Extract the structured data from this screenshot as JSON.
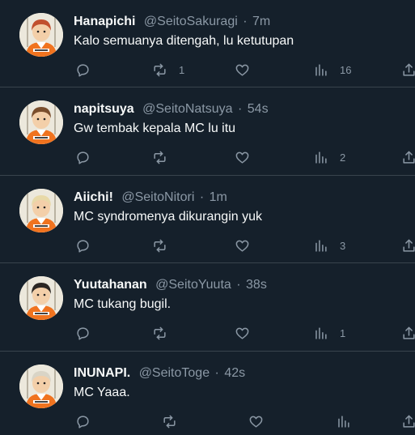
{
  "tweets": [
    {
      "name": "Hanapichi",
      "handle": "@SeitoSakuragi",
      "sep": "·",
      "time": "7m",
      "text": "Kalo semuanya ditengah, lu ketutupan",
      "retweets": "1",
      "views": "16",
      "avatar_hair": "#c1502e"
    },
    {
      "name": "napitsuya",
      "handle": "@SeitoNatsuya",
      "sep": "·",
      "time": "54s",
      "text": "Gw tembak kepala MC lu itu",
      "retweets": "",
      "views": "2",
      "avatar_hair": "#7a4e2c"
    },
    {
      "name": "Aiichi!",
      "handle": "@SeitoNitori",
      "sep": "·",
      "time": "1m",
      "text": "MC syndromenya dikurangin yuk",
      "retweets": "",
      "views": "3",
      "avatar_hair": "#e8d9a8"
    },
    {
      "name": "Yuutahanan",
      "handle": "@SeitoYuuta",
      "sep": "·",
      "time": "38s",
      "text": "MC tukang bugil.",
      "retweets": "",
      "views": "1",
      "avatar_hair": "#2b2623"
    },
    {
      "name": "INUNAPI.",
      "handle": "@SeitoToge",
      "sep": "·",
      "time": "42s",
      "text": "MC Yaaa.",
      "retweets": "",
      "views": "",
      "avatar_hair": "#d9d4c6"
    }
  ],
  "icons": {
    "reply": "reply-icon",
    "retweet": "retweet-icon",
    "like": "like-icon",
    "views": "views-icon",
    "share": "share-icon"
  },
  "colors": {
    "background": "#15202b",
    "muted": "#8b98a5",
    "divider": "#38444d",
    "text": "#f7f9f9",
    "jersey": "#f0731f"
  }
}
